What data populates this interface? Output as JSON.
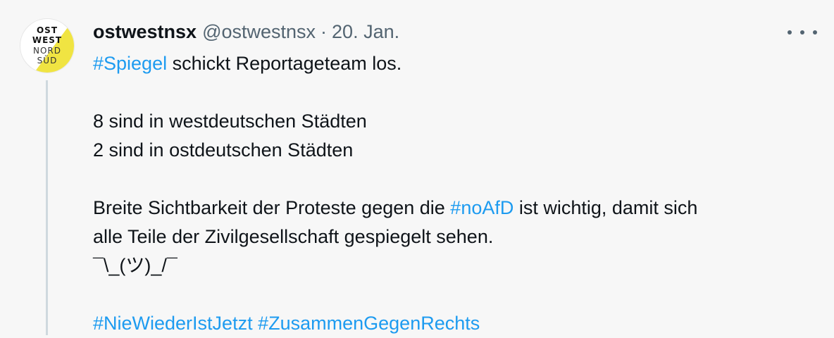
{
  "avatar": {
    "lines": [
      "OST",
      "WEST",
      "NORD",
      "SÜD"
    ],
    "colors": {
      "dark": "#111111",
      "accent": "#f0e442",
      "background": "#ffffff"
    }
  },
  "header": {
    "display_name": "ostwestnsx",
    "handle": "@ostwestnsx",
    "separator": "·",
    "date": "20. Jan."
  },
  "more_menu": {
    "icon": "more-horizontal-icon"
  },
  "body": {
    "line1": {
      "hashtag": "#Spiegel",
      "text": " schickt Reportageteam los."
    },
    "line2": "8 sind in westdeutschen Städten",
    "line3": "2 sind in ostdeutschen Städten",
    "line4": {
      "before": "Breite Sichtbarkeit der Proteste gegen die ",
      "hashtag": "#noAfD",
      "after": " ist wichtig, damit sich"
    },
    "line5": "alle Teile der Zivilgesellschaft gespiegelt sehen.",
    "line6": "¯\\_(ツ)_/¯",
    "line7": {
      "hashtag1": "#NieWiederIstJetzt",
      "space": " ",
      "hashtag2": "#ZusammenGegenRechts"
    }
  },
  "colors": {
    "link": "#1d9bf0",
    "muted": "#536471",
    "text": "#0f1419",
    "thread_line": "#cfd9de",
    "background": "#f7f7f7"
  }
}
